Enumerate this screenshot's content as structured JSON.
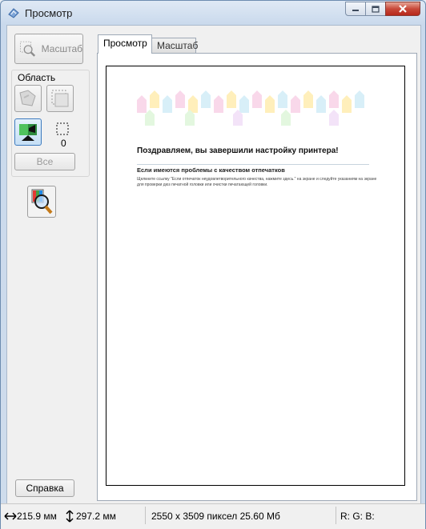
{
  "window": {
    "title": "Просмотр"
  },
  "left_panel": {
    "zoom_button_label": "Масштаб",
    "area_group_label": "Область",
    "marquee_count": "0",
    "all_button_label": "Все"
  },
  "tabs": [
    {
      "label": "Просмотр",
      "active": true
    },
    {
      "label": "Масштаб",
      "active": false
    }
  ],
  "preview_document": {
    "heading": "Поздравляем, вы завершили настройку принтера!",
    "subheading": "Если имеются проблемы с качеством отпечатков",
    "body": "Щелкните ссылку \"Если отпечаток неудовлетворительного качества, нажмите здесь.\" на экране и следуйте указаниям на экране для проверки дюз печатной головки или очистки печатающей головки."
  },
  "help_button_label": "Справка",
  "status_bar": {
    "width": "215.9 мм",
    "height": "297.2 мм",
    "pixel_info": "2550 x 3509 пиксел 25.60 Мб",
    "rgb": "R: G: B:"
  },
  "colors": {
    "accent_blue": "#2f6fb5",
    "close_red": "#c8493a"
  }
}
